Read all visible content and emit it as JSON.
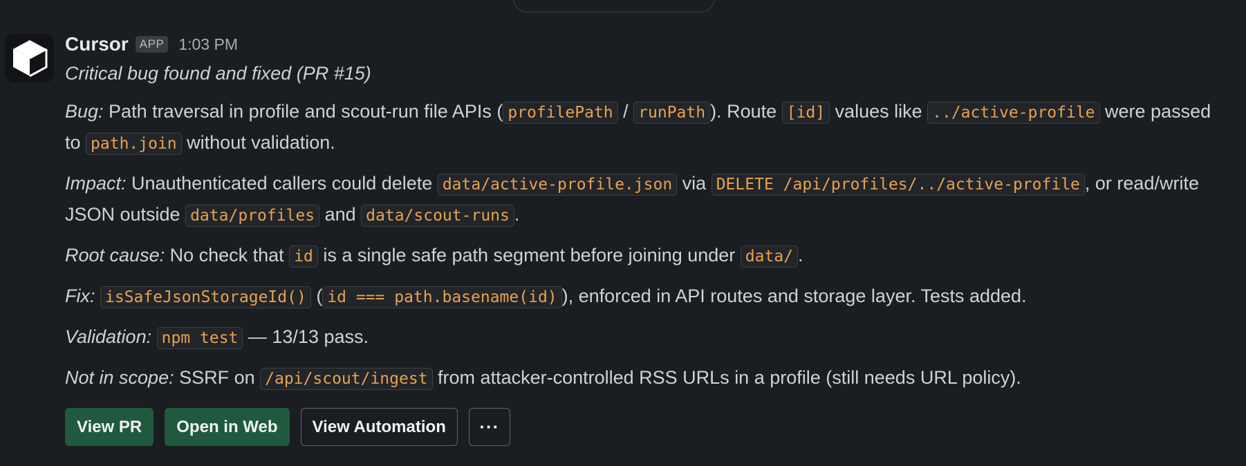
{
  "message": {
    "sender": "Cursor",
    "badge": "APP",
    "time": "1:03 PM",
    "subtitle": "Critical bug found and fixed (PR #15)"
  },
  "bug": {
    "label": "Bug:",
    "t1": " Path traversal in profile and scout-run file APIs (",
    "c1": "profilePath",
    "t2": " / ",
    "c2": "runPath",
    "t3": "). Route ",
    "c3": "[id]",
    "t4": " values like ",
    "c4": "../active-profile",
    "t5": " were passed to ",
    "c5": "path.join",
    "t6": " without validation."
  },
  "impact": {
    "label": "Impact:",
    "t1": " Unauthenticated callers could delete ",
    "c1": "data/active-profile.json",
    "t2": " via ",
    "c2": "DELETE /api/profiles/../active-profile",
    "t3": ", or read/write JSON outside ",
    "c3": "data/profiles",
    "t4": " and ",
    "c4": "data/scout-runs",
    "t5": "."
  },
  "root_cause": {
    "label": "Root cause:",
    "t1": " No check that ",
    "c1": "id",
    "t2": " is a single safe path segment before joining under ",
    "c2": "data/",
    "t3": "."
  },
  "fix": {
    "label": "Fix:",
    "t0": " ",
    "c1": "isSafeJsonStorageId()",
    "t1": " (",
    "c2": "id === path.basename(id)",
    "t2": "), enforced in API routes and storage layer. Tests added."
  },
  "validation": {
    "label": "Validation:",
    "t0": " ",
    "c1": "npm test",
    "t1": " — 13/13 pass."
  },
  "not_in_scope": {
    "label": "Not in scope:",
    "t1": " SSRF on ",
    "c1": "/api/scout/ingest",
    "t2": " from attacker-controlled RSS URLs in a profile (still needs URL policy)."
  },
  "buttons": {
    "view_pr": "View PR",
    "open_web": "Open in Web",
    "view_automation": "View Automation",
    "more": "···"
  },
  "icons": {
    "avatar": "cursor-cube-logo-icon"
  },
  "colors": {
    "background": "#1a1d21",
    "code_text": "#e8a24f",
    "primary_button": "#1f5a3f"
  }
}
